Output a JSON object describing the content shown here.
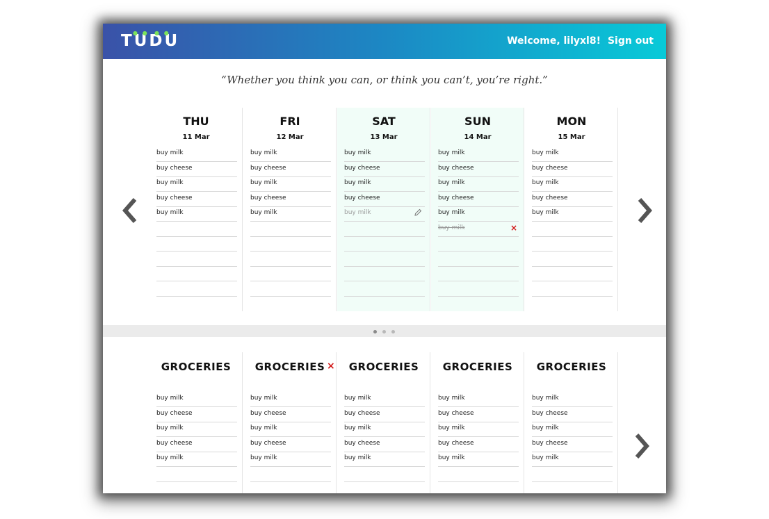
{
  "header": {
    "logo": "TUDU",
    "welcome": "Welcome, lilyxl8!",
    "sign_out": "Sign out",
    "logo_dot_color": "#7be35a"
  },
  "quote": "“Whether you think you can, or think you can’t, you’re right.”",
  "days": [
    {
      "name": "THU",
      "date": "11 Mar",
      "tasks": [
        "buy milk",
        "buy cheese",
        "buy milk",
        "buy cheese",
        "buy milk"
      ]
    },
    {
      "name": "FRI",
      "date": "12 Mar",
      "tasks": [
        "buy milk",
        "buy cheese",
        "buy milk",
        "buy cheese",
        "buy milk"
      ]
    },
    {
      "name": "SAT",
      "date": "13 Mar",
      "tasks": [
        "buy milk",
        "buy cheese",
        "buy milk",
        "buy cheese"
      ],
      "editing": "buy milk"
    },
    {
      "name": "SUN",
      "date": "14 Mar",
      "tasks": [
        "buy milk",
        "buy cheese",
        "buy milk",
        "buy cheese",
        "buy milk"
      ],
      "completed": "buy milk"
    },
    {
      "name": "MON",
      "date": "15 Mar",
      "tasks": [
        "buy milk",
        "buy cheese",
        "buy milk",
        "buy cheese",
        "buy milk"
      ]
    }
  ],
  "lists": [
    {
      "title": "GROCERIES",
      "tasks": [
        "buy milk",
        "buy cheese",
        "buy milk",
        "buy cheese",
        "buy milk"
      ]
    },
    {
      "title": "GROCERIES",
      "tasks": [
        "buy milk",
        "buy cheese",
        "buy milk",
        "buy cheese",
        "buy milk"
      ],
      "delete_icon": "×"
    },
    {
      "title": "GROCERIES",
      "tasks": [
        "buy milk",
        "buy cheese",
        "buy milk",
        "buy cheese",
        "buy milk"
      ]
    },
    {
      "title": "GROCERIES",
      "tasks": [
        "buy milk",
        "buy cheese",
        "buy milk",
        "buy cheese",
        "buy milk"
      ]
    },
    {
      "title": "GROCERIES",
      "tasks": [
        "buy milk",
        "buy cheese",
        "buy milk",
        "buy cheese",
        "buy milk"
      ]
    }
  ],
  "sun_delete_icon": "×",
  "pager": {
    "count": 3,
    "active": 0
  },
  "colors": {
    "accent_start": "#3a52a8",
    "accent_end": "#08cad8",
    "today_bg": "#f1fdf8",
    "delete": "#d21a1a"
  },
  "icons": [
    "prev-arrow-icon",
    "next-arrow-icon",
    "pencil-icon",
    "delete-icon"
  ]
}
